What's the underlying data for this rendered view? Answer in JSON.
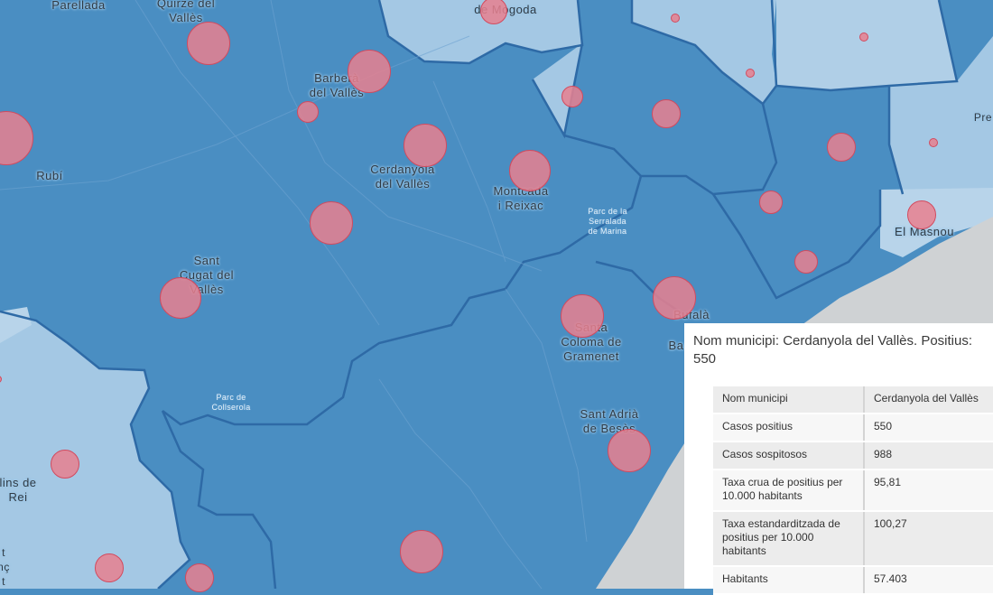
{
  "colors": {
    "dark_region": "#4a8ec2",
    "light_region": "#a4c8e4",
    "pale_region": "#b8d4ea",
    "sea": "#cfd2d4",
    "boundary": "#2e6aa6",
    "marker_fill": "#e8808f"
  },
  "map": {
    "labels": [
      {
        "text": "Parellada",
        "kind": "town"
      },
      {
        "text": "Quirze del\nVallès",
        "kind": "town"
      },
      {
        "text": "de Mogoda",
        "kind": "town"
      },
      {
        "text": "Barberà\ndel Vallès",
        "kind": "town"
      },
      {
        "text": "Rubí",
        "kind": "town"
      },
      {
        "text": "Cerdanyola\ndel Vallès",
        "kind": "town"
      },
      {
        "text": "Montcada\ni Reixac",
        "kind": "town"
      },
      {
        "text": "Parc de la\nSerralada\nde Marina",
        "kind": "park"
      },
      {
        "text": "Sant\nCugat del\nVallès",
        "kind": "town"
      },
      {
        "text": "Bufalà",
        "kind": "town"
      },
      {
        "text": "Santa\nColoma de\nGramenet",
        "kind": "town"
      },
      {
        "text": "Ba",
        "kind": "town"
      },
      {
        "text": "Parc de\nCollserola",
        "kind": "park"
      },
      {
        "text": "Sant Adrià\nde Besòs",
        "kind": "town"
      },
      {
        "text": "El Masnou",
        "kind": "town"
      },
      {
        "text": "Pre",
        "kind": "town"
      },
      {
        "text": "lins de\nRei",
        "kind": "town"
      },
      {
        "text": "t\nnç\nt",
        "kind": "town"
      }
    ],
    "marker_count": 28
  },
  "popup": {
    "title": "Nom municipi: Cerdanyola del Vallès. Positius: 550",
    "rows": [
      {
        "key": "Nom municipi",
        "value": "Cerdanyola del Vallès"
      },
      {
        "key": "Casos positius",
        "value": "550"
      },
      {
        "key": "Casos sospitosos",
        "value": "988"
      },
      {
        "key": "Taxa crua de positius per 10.000 habitants",
        "value": "95,81"
      },
      {
        "key": "Taxa estandarditzada de positius per 10.000 habitants",
        "value": "100,27"
      },
      {
        "key": "Habitants",
        "value": "57.403"
      }
    ]
  }
}
